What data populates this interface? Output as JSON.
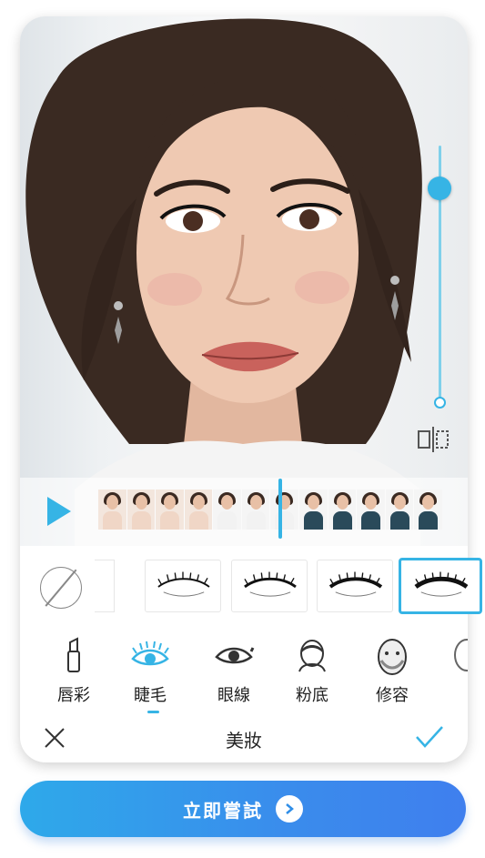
{
  "colors": {
    "accent": "#36b4e5",
    "cta_start": "#2ea9ea",
    "cta_end": "#3f7fee"
  },
  "preview": {
    "slider_icon": "slider-knob",
    "compare_icon": "compare-split-icon",
    "intensity_level": 0.87
  },
  "timeline": {
    "play_icon": "play-icon",
    "frame_count": 12
  },
  "styles": {
    "none_icon": "no-style-icon",
    "items": [
      "eyelash-style-1",
      "eyelash-style-2",
      "eyelash-style-3",
      "eyelash-style-4"
    ],
    "selected_index": 3
  },
  "categories": [
    {
      "label": "唇彩",
      "icon": "lipstick-icon"
    },
    {
      "label": "睫毛",
      "icon": "eyelash-icon"
    },
    {
      "label": "眼線",
      "icon": "eyeliner-icon"
    },
    {
      "label": "粉底",
      "icon": "foundation-icon"
    },
    {
      "label": "修容",
      "icon": "contour-icon"
    }
  ],
  "selected_category": 1,
  "bottom_bar": {
    "title": "美妝",
    "close_icon": "close-icon",
    "confirm_icon": "check-icon"
  },
  "cta": {
    "label": "立即嘗試",
    "icon": "chevron-right-icon"
  }
}
